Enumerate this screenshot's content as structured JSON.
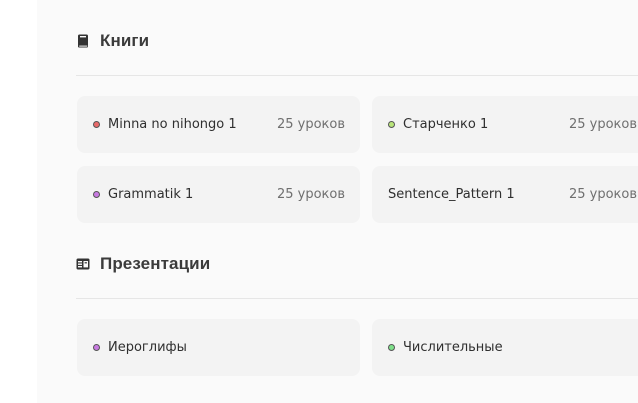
{
  "books": {
    "title": "Книги",
    "icon": "book-icon",
    "items": [
      {
        "title": "Minna no nihongo 1",
        "lessons": "25 уроков",
        "dot_color": "#e86a6a"
      },
      {
        "title": "Старченко 1",
        "lessons": "25 уроков",
        "dot_color": "#b9e57a"
      },
      {
        "title": "Grammatik 1",
        "lessons": "25 уроков",
        "dot_color": "#c77ae0"
      },
      {
        "title": "Sentence_Pattern 1",
        "lessons": "25 уроков",
        "dot_color": null
      }
    ]
  },
  "presentations": {
    "title": "Презентации",
    "icon": "presentation-icon",
    "items": [
      {
        "title": "Иероглифы",
        "dot_color": "#c77ae0"
      },
      {
        "title": "Числительные",
        "dot_color": "#7ee08a"
      }
    ]
  }
}
